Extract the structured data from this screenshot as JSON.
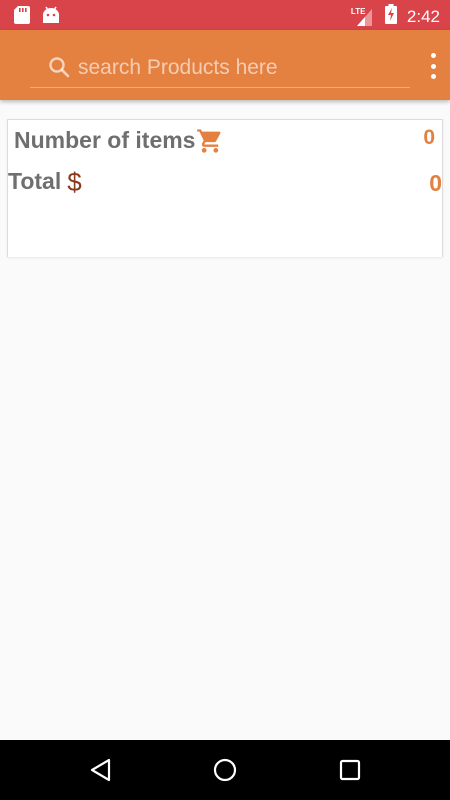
{
  "status_bar": {
    "time": "2:42",
    "network": "LTE",
    "left_icons": [
      "sd-card-icon",
      "android-icon"
    ],
    "background_color": "#d9434a"
  },
  "app_bar": {
    "search_placeholder": "search Products here",
    "search_value": "",
    "background_color": "#e48040"
  },
  "summary": {
    "items_label": "Number of items",
    "items_count": "0",
    "total_label": "Total",
    "total_value": "0",
    "accent_color": "#e48040"
  },
  "nav_bar": {
    "buttons": [
      "back",
      "home",
      "recents"
    ]
  }
}
